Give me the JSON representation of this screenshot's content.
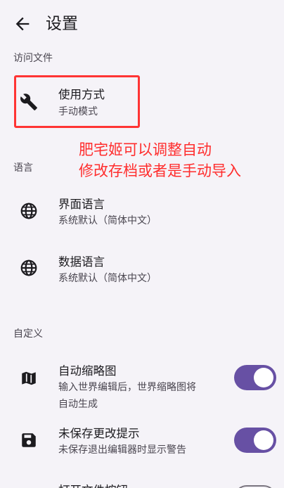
{
  "appbar": {
    "title": "设置",
    "back_icon": "arrow-left-icon"
  },
  "sections": {
    "files": {
      "header": "访问文件"
    },
    "language": {
      "header": "语言"
    },
    "custom": {
      "header": "自定义"
    }
  },
  "items": {
    "usage": {
      "label": "使用方式",
      "value": "手动模式",
      "icon": "tools-icon"
    },
    "ui_language": {
      "label": "界面语言",
      "value": "系统默认（简体中文）",
      "icon": "globe-icon"
    },
    "data_language": {
      "label": "数据语言",
      "value": "系统默认（简体中文）",
      "icon": "globe-icon"
    },
    "auto_thumbnail": {
      "label": "自动缩略图",
      "desc_line1": "输入世界编辑后，世界缩略图将",
      "desc_line2": "自动生成",
      "icon": "map-icon",
      "enabled": true
    },
    "unsaved_prompt": {
      "label": "未保存更改提示",
      "desc": "未保存退出编辑器时显示警告",
      "icon": "save-icon",
      "enabled": true
    },
    "open_file_button": {
      "label": "打开文件按钮",
      "enabled": false
    }
  },
  "annotation": {
    "line1": "肥宅姬可以调整自动",
    "line2": "修改存档或者是手动导入",
    "color": "#ff2d2d"
  },
  "colors": {
    "accent": "#6750a4",
    "highlight": "#ff3434",
    "background": "#f5f3f8"
  }
}
